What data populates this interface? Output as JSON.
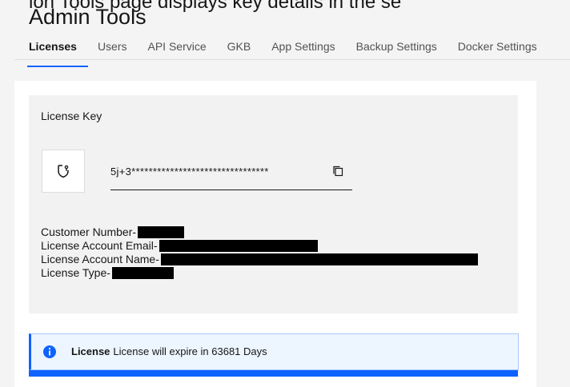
{
  "header": {
    "cropped_text": "ion Tools page displays key details in the se",
    "title": "Admin Tools"
  },
  "tabs": [
    {
      "label": "Licenses",
      "active": true
    },
    {
      "label": "Users",
      "active": false
    },
    {
      "label": "API Service",
      "active": false
    },
    {
      "label": "GKB",
      "active": false
    },
    {
      "label": "App Settings",
      "active": false
    },
    {
      "label": "Backup Settings",
      "active": false
    },
    {
      "label": "Docker Settings",
      "active": false
    }
  ],
  "license": {
    "heading": "License Key",
    "key_value": "5j+3********************************",
    "key_icon": "shield-key-icon",
    "copy_icon": "copy-icon",
    "details": [
      {
        "label": "Customer Number-",
        "redacted": true
      },
      {
        "label": "License Account Email-",
        "redacted": true
      },
      {
        "label": "License Account Name-",
        "redacted": true
      },
      {
        "label": "License Type-",
        "redacted": true
      }
    ]
  },
  "notification": {
    "icon": "info-icon",
    "title": "License",
    "message": "License will expire in 63681 Days"
  },
  "colors": {
    "accent": "#0f62fe",
    "page_bg": "#f4f4f4",
    "panel_bg": "#f2f2f2",
    "alert_bg": "#edf5ff"
  }
}
